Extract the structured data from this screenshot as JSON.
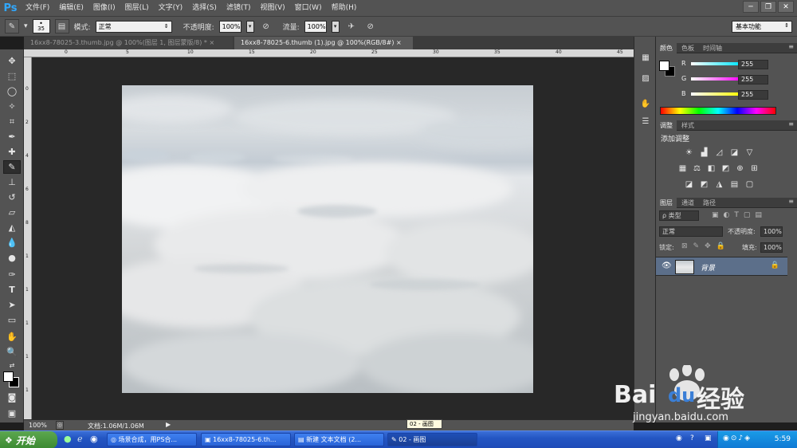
{
  "app": {
    "logo": "Ps"
  },
  "menubar": {
    "items": [
      "文件(F)",
      "编辑(E)",
      "图像(I)",
      "图层(L)",
      "文字(Y)",
      "选择(S)",
      "滤镜(T)",
      "视图(V)",
      "窗口(W)",
      "帮助(H)"
    ]
  },
  "options": {
    "brush_size": "35",
    "mode_label": "模式:",
    "mode_value": "正常",
    "opacity_label": "不透明度:",
    "opacity_value": "100%",
    "flow_label": "流量:",
    "flow_value": "100%",
    "workspace": "基本功能"
  },
  "tabs": [
    {
      "label": "16xx8-78025-3.thumb.jpg @ 100%(图层 1, 图层蒙版/8) *"
    },
    {
      "label": "16xx8-78025-6.thumb (1).jpg @ 100%(RGB/8#)"
    }
  ],
  "status": {
    "zoom": "100%",
    "doc_info": "文档:1.06M/1.06M"
  },
  "tooltip": "02 - 画图",
  "ruler": {
    "top": [
      "0",
      "5",
      "10",
      "15",
      "20",
      "25",
      "30",
      "35",
      "40",
      "45",
      "50"
    ],
    "left": [
      "0",
      "2",
      "4",
      "6",
      "8",
      "1",
      "1",
      "1",
      "1",
      "1",
      "2"
    ]
  },
  "color_panel": {
    "tabs": [
      "颜色",
      "色板",
      "时间轴"
    ],
    "channels": [
      {
        "label": "R",
        "value": "255"
      },
      {
        "label": "G",
        "value": "255"
      },
      {
        "label": "B",
        "value": "255"
      }
    ],
    "colors": {
      "r": "#00e5ff",
      "g": "#ff00ff",
      "b": "#ffff00"
    }
  },
  "adjust_panel": {
    "tabs": [
      "调整",
      "样式"
    ],
    "title": "添加调整"
  },
  "layers_panel": {
    "tabs": [
      "图层",
      "通道",
      "路径"
    ],
    "filter": "ρ 类型",
    "blend": "正常",
    "opacity_label": "不透明度:",
    "opacity_value": "100%",
    "lock_label": "锁定:",
    "fill_label": "填充:",
    "fill_value": "100%",
    "layer_name": "背景"
  },
  "taskbar": {
    "start": "开始",
    "buttons": [
      "场景合成，用PS合...",
      "16xx8-78025-6.th...",
      "新建 文本文档 (2...",
      "02 - 画图"
    ],
    "clock": "5:59"
  },
  "watermark": {
    "brand": "Bai",
    "brand2": "du",
    "cn": "经验",
    "url": "jingyan.baidu.com"
  },
  "accent": "#31a8ff"
}
